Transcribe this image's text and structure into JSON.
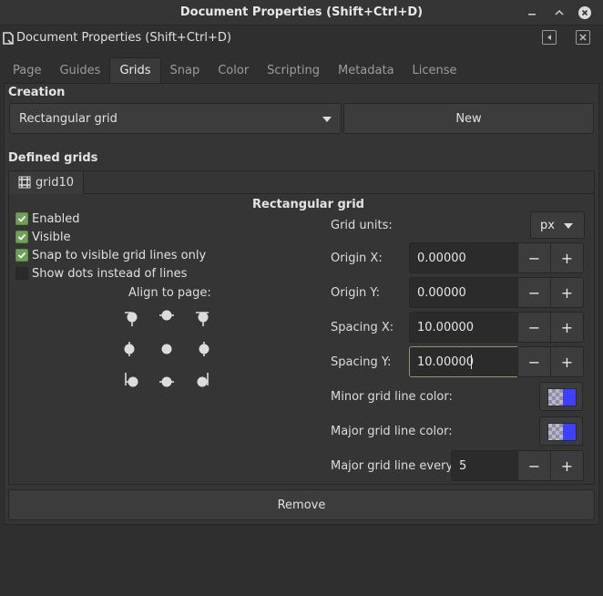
{
  "window": {
    "title": "Document Properties (Shift+Ctrl+D)"
  },
  "dock": {
    "title": "Document Properties (Shift+Ctrl+D)"
  },
  "tabs": [
    {
      "label": "Page"
    },
    {
      "label": "Guides"
    },
    {
      "label": "Grids"
    },
    {
      "label": "Snap"
    },
    {
      "label": "Color"
    },
    {
      "label": "Scripting"
    },
    {
      "label": "Metadata"
    },
    {
      "label": "License"
    }
  ],
  "active_tab": "Grids",
  "creation": {
    "heading": "Creation",
    "grid_type_selected": "Rectangular grid",
    "new_label": "New"
  },
  "defined_grids": {
    "heading": "Defined grids",
    "grid_tab_label": "grid10",
    "grid_type_title": "Rectangular grid",
    "options": [
      {
        "label": "Enabled",
        "checked": true
      },
      {
        "label": "Visible",
        "checked": true
      },
      {
        "label": "Snap to visible grid lines only",
        "checked": true
      },
      {
        "label": "Show dots instead of lines",
        "checked": false
      }
    ],
    "align_label": "Align to page:",
    "grid_units_label": "Grid units:",
    "grid_units_value": "px",
    "origin_x_label": "Origin X:",
    "origin_x_value": "0.00000",
    "origin_y_label": "Origin Y:",
    "origin_y_value": "0.00000",
    "spacing_x_label": "Spacing X:",
    "spacing_x_value": "10.00000",
    "spacing_y_label": "Spacing Y:",
    "spacing_y_value": "10.00000",
    "minor_color_label": "Minor grid line color:",
    "minor_color": "#3f3fff",
    "major_color_label": "Major grid line color:",
    "major_color": "#3f3fff",
    "major_every_label": "Major grid line every:",
    "major_every_value": "5",
    "remove_label": "Remove"
  },
  "icons": {
    "minimize": "minimize-icon",
    "maximize": "maximize-icon",
    "close": "close-icon",
    "dock_float": "float-icon",
    "dock_close": "close-icon",
    "grid": "grid-icon"
  },
  "spin_minus": "−",
  "spin_plus": "+"
}
